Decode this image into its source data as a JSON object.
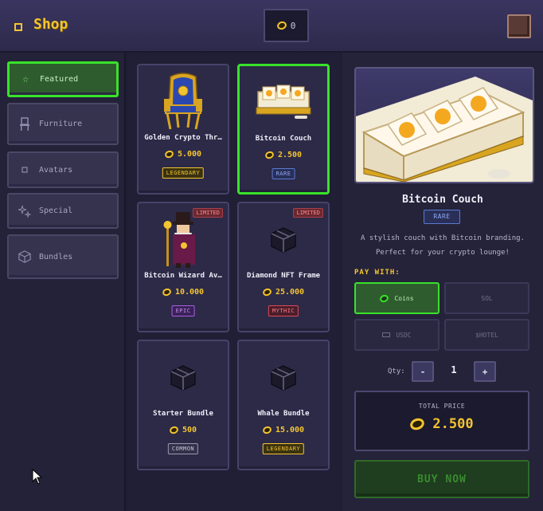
{
  "header": {
    "title": "Shop",
    "balance": "0"
  },
  "sidebar": {
    "items": [
      {
        "label": "Featured",
        "icon": "star-icon",
        "active": true
      },
      {
        "label": "Furniture",
        "icon": "chair-icon",
        "active": false
      },
      {
        "label": "Avatars",
        "icon": "avatar-icon",
        "active": false
      },
      {
        "label": "Special",
        "icon": "sparkle-icon",
        "active": false
      },
      {
        "label": "Bundles",
        "icon": "box-icon",
        "active": false
      }
    ]
  },
  "items": [
    {
      "name": "Golden Crypto Thr…",
      "price": "5.000",
      "rarity": "LEGENDARY",
      "limited": ""
    },
    {
      "name": "Bitcoin Couch",
      "price": "2.500",
      "rarity": "RARE",
      "limited": ""
    },
    {
      "name": "Bitcoin Wizard Av…",
      "price": "10.000",
      "rarity": "EPIC",
      "limited": "LIMITED"
    },
    {
      "name": "Diamond NFT Frame",
      "price": "25.000",
      "rarity": "MYTHIC",
      "limited": "LIMITED"
    },
    {
      "name": "Starter Bundle",
      "price": "500",
      "rarity": "COMMON",
      "limited": ""
    },
    {
      "name": "Whale Bundle",
      "price": "15.000",
      "rarity": "LEGENDARY",
      "limited": ""
    }
  ],
  "rarity_colors": {
    "LEGENDARY": "#f4c430",
    "RARE": "#5a7ad0",
    "EPIC": "#a860e0",
    "MYTHIC": "#e04858",
    "COMMON": "#9a98b0"
  },
  "detail": {
    "name": "Bitcoin Couch",
    "rarity": "RARE",
    "description_line1": "A stylish couch with Bitcoin branding.",
    "description_line2": "Perfect for your crypto lounge!",
    "pay_label": "PAY WITH:",
    "pay_options": [
      "Coins",
      "SOL",
      "USDC",
      "$HOTEL"
    ],
    "qty_label": "Qty:",
    "qty_minus": "-",
    "qty_value": "1",
    "qty_plus": "+",
    "total_label": "TOTAL PRICE",
    "total_value": "2.500",
    "buy_label": "BUY NOW"
  },
  "colors": {
    "accent_gold": "#f4c430",
    "active_green": "#39e22a",
    "background": "#1f1d33"
  }
}
